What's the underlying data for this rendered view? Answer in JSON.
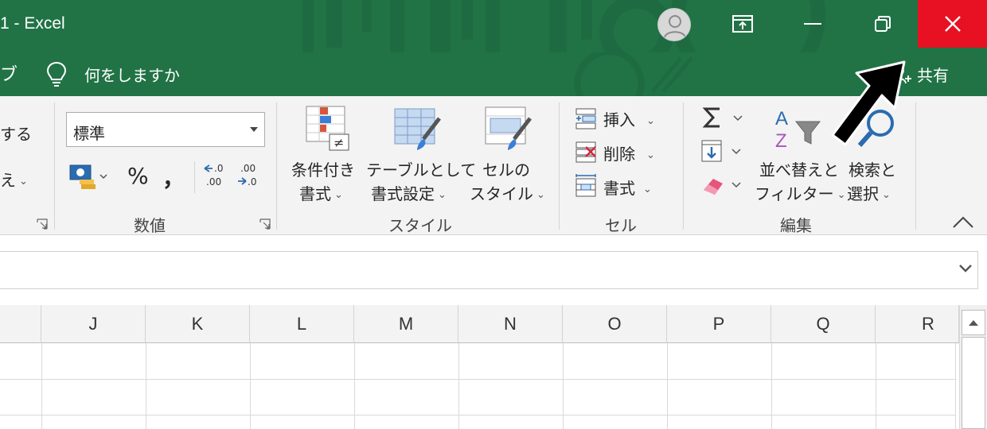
{
  "titlebar": {
    "title": "1 - Excel",
    "colors": {
      "bar": "#217346",
      "close": "#e81123"
    }
  },
  "tellme": {
    "left_fragment": "ブ",
    "placeholder": "何をしますか",
    "share_label": "共有"
  },
  "ribbon": {
    "left_fragment_1": "する",
    "left_fragment_2": "え",
    "number": {
      "format_value": "標準",
      "percent": "%",
      "comma": "，",
      "group_label": "数値"
    },
    "styles": {
      "conditional_line1": "条件付き",
      "conditional_line2": "書式",
      "table_line1": "テーブルとして",
      "table_line2": "書式設定",
      "cell_line1": "セルの",
      "cell_line2": "スタイル",
      "group_label": "スタイル"
    },
    "cells": {
      "insert": "挿入",
      "delete": "削除",
      "format": "書式",
      "group_label": "セル"
    },
    "editing": {
      "sort_line1": "並べ替えと",
      "sort_line2": "フィルター",
      "find_line1": "検索と",
      "find_line2": "選択",
      "group_label": "編集"
    }
  },
  "grid": {
    "columns": [
      "J",
      "K",
      "L",
      "M",
      "N",
      "O",
      "P",
      "Q",
      "R"
    ]
  }
}
